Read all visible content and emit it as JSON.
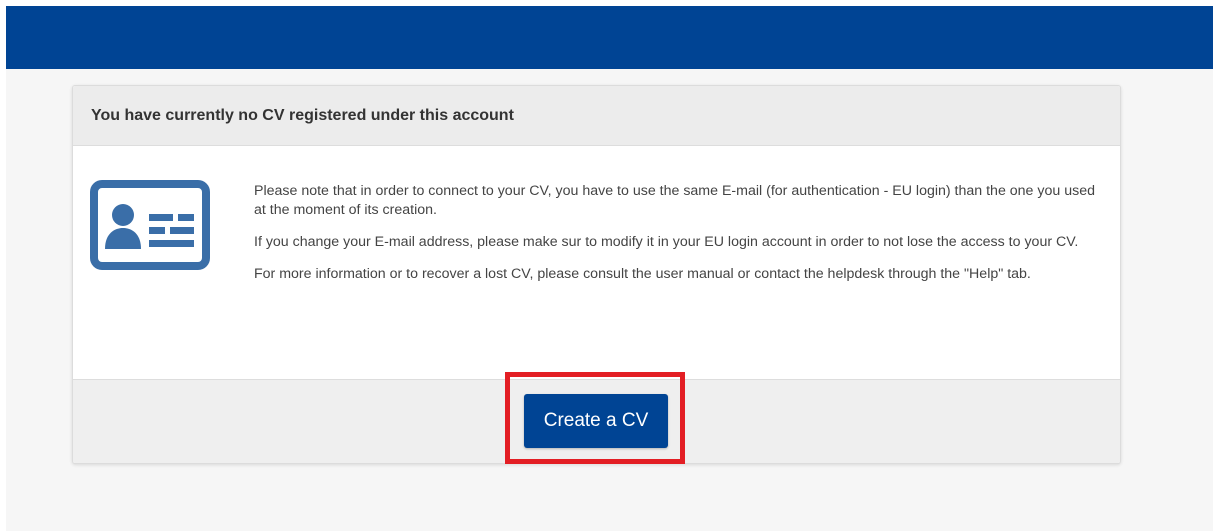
{
  "header": {
    "background_color": "#004494"
  },
  "card": {
    "title": "You have currently no CV registered under this account",
    "icon": "id-card-icon",
    "paragraphs": [
      "Please note that in order to connect to your CV, you have to use the same E-mail (for authentication - EU login) than the one you used at the moment of its creation.",
      "If you change your E-mail address, please make sur to modify it in your EU login account in order to not lose the access to your CV.",
      "For more information or to recover a lost CV, please consult the user manual or contact the helpdesk through the \"Help\" tab."
    ]
  },
  "actions": {
    "create_cv_label": "Create a CV",
    "button_color": "#004494",
    "highlight_color": "#e31e24"
  }
}
